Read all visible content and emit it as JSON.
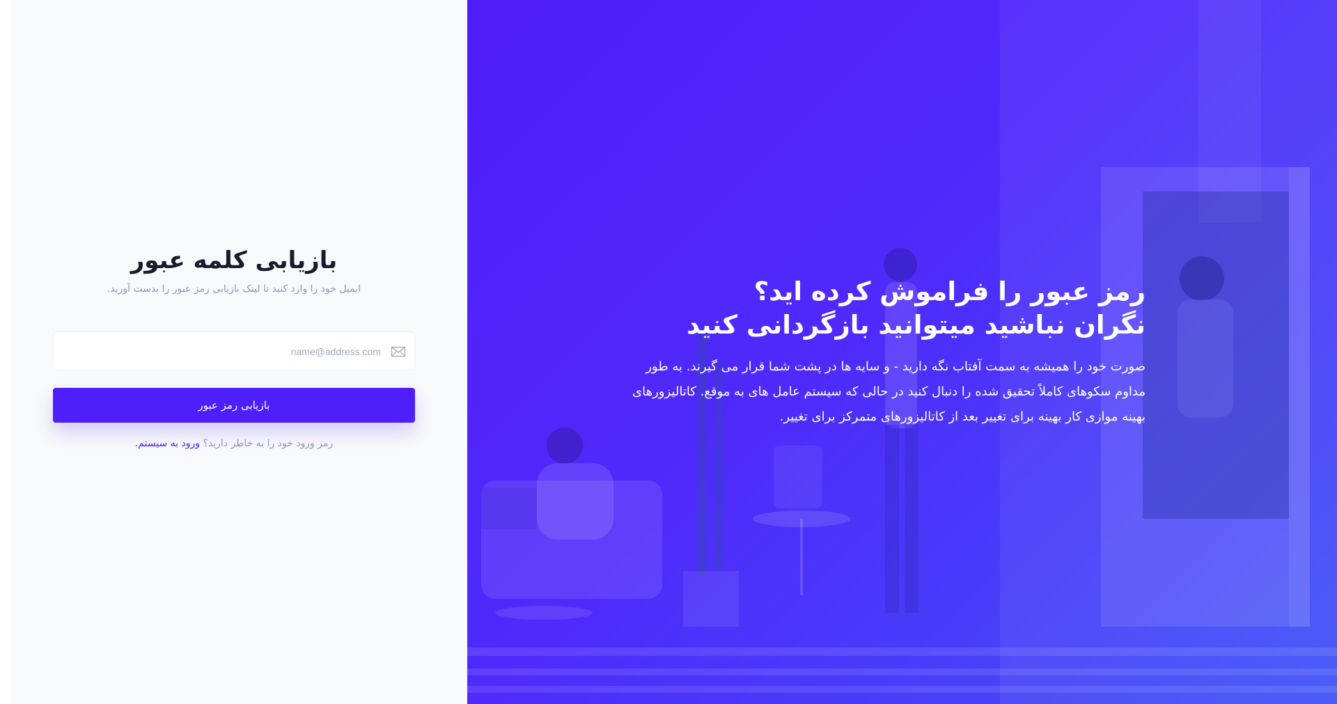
{
  "form": {
    "title": "بازیابی کلمه عبور",
    "subtitle": "ایمیل خود را وارد کنید تا لینک بازیابی رمز عبور را بدست آورید.",
    "email": {
      "placeholder": "name@address.com",
      "value": "",
      "icon": "envelope-icon"
    },
    "submit_label": "بازیابی رمز عبور",
    "remember_text": "رمز ورود خود را به خاطر دارید؟",
    "login_link": "ورود به سیستم."
  },
  "hero": {
    "title_line1": "رمز عبور را فراموش کرده اید؟",
    "title_line2": "نگران نباشید میتوانید بازگردانی کنید",
    "description": "صورت خود را همیشه به سمت آفتاب نگه دارید - و سایه ها در پشت شما قرار می گیرند. به طور مداوم سکوهای کاملاً تحقیق شده را دنبال کنید در حالی که سیستم عامل های به موقع. کاتالیزورهای بهینه موازی کار بهینه برای تغییر بعد از کاتالیزورهای متمرکز برای تغییر."
  },
  "colors": {
    "accent": "#4e1efb",
    "heading": "#161c2d",
    "muted": "#869ab8",
    "panel_bg": "#f8f9fa",
    "hero_gradient_start": "#4f1dfb",
    "hero_gradient_end": "#3f53f8"
  }
}
